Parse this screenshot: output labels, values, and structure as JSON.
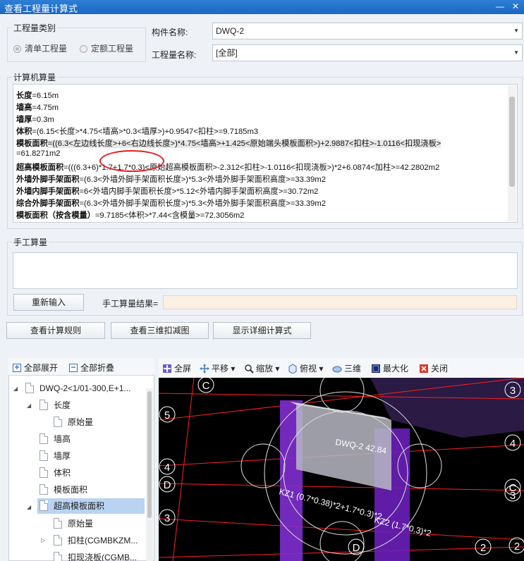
{
  "window": {
    "title": "查看工程量计算式",
    "minimize": "—",
    "close": "✕"
  },
  "qty_type": {
    "group_label": "工程量类别",
    "opt1": "清单工程量",
    "opt2": "定额工程量"
  },
  "component": {
    "label": "构件名称:",
    "value": "DWQ-2"
  },
  "qty_name": {
    "label": "工程量名称:",
    "value": "[全部]"
  },
  "calc": {
    "group_label": "计算机算量",
    "lines": [
      {
        "name": "长度",
        "expr": "=6.15m"
      },
      {
        "name": "墙高",
        "expr": "=4.75m"
      },
      {
        "name": "墙厚",
        "expr": "=0.3m"
      },
      {
        "name": "体积",
        "expr": "=(6.15<长度>*4.75<墙高>*0.3<墙厚>)+0.9547<扣柱>=9.7185m3"
      },
      {
        "name": "模板面积",
        "expr": "=((6.3<左边线长度>+6<右边线长度>)*4.75<墙高>+1.425<原始端头模板面积>)+2.9887<扣柱>-1.0116<扣现浇板>"
      },
      {
        "name": "",
        "expr": "=61.8271m2"
      },
      {
        "name": "超高模板面积",
        "expr": "=(((6.3+6)*1.7+1.7*0.3)<原始超高模板面积>-2.312<扣柱>-1.0116<扣现浇板>)*2+6.0874<加柱>=42.2802m2"
      },
      {
        "name": "外墙外脚手架面积",
        "expr": "=(6.3<外墙外脚手架面积长度>)*5.3<外墙外脚手架面积高度>=33.39m2"
      },
      {
        "name": "外墙内脚手架面积",
        "expr": "=6<外墙内脚手架面积长度>*5.12<外墙内脚手架面积高度>=30.72m2"
      },
      {
        "name": "综合外脚手架面积",
        "expr": "=(6.3<外墙外脚手架面积长度>)*5.3<外墙外脚手架面积高度>=33.39m2"
      },
      {
        "name": "模板面积（按含模量）",
        "expr": "=9.7185<体积>*7.44<含模量>=72.3056m2"
      }
    ]
  },
  "manual": {
    "group_label": "手工算量",
    "reinput": "重新输入",
    "result_label": "手工算量结果=",
    "result_value": ""
  },
  "buttons": {
    "rules": "查看计算规则",
    "view3d": "查看三维扣减图",
    "detail": "显示详细计算式"
  },
  "tree": {
    "expand_all": "全部展开",
    "collapse_all": "全部折叠",
    "nodes": [
      "DWQ-2<1/01-300,E+1...",
      "长度",
      "原始量",
      "墙高",
      "墙厚",
      "体积",
      "模板面积",
      "超高模板面积",
      "原始量",
      "扣柱(CGMBKZM...",
      "扣现浇板(CGMB..."
    ]
  },
  "view_toolbar": {
    "fullscreen": "全屏",
    "pan": "平移",
    "zoom": "缩放",
    "top": "俯视",
    "three_d": "三维",
    "maximize": "最大化",
    "close": "关闭"
  },
  "scene": {
    "label_wall": "DWQ-2 42.84",
    "label_col1": "KZ1 (0.7*0.38)*2+1.7*0.3)*2",
    "label_col2": "KZ2 (1.7*0.3)*2",
    "axis_labels": [
      "C",
      "5",
      "4",
      "D",
      "3",
      "D",
      "3",
      "4",
      "C",
      "3",
      "2",
      "2"
    ]
  },
  "colors": {
    "title_bar": "#1a66c2",
    "highlight_circle": "#e02020",
    "wall": "#7f2fd0",
    "axis": "#ff2020",
    "result_bg": "#fcefe4"
  }
}
